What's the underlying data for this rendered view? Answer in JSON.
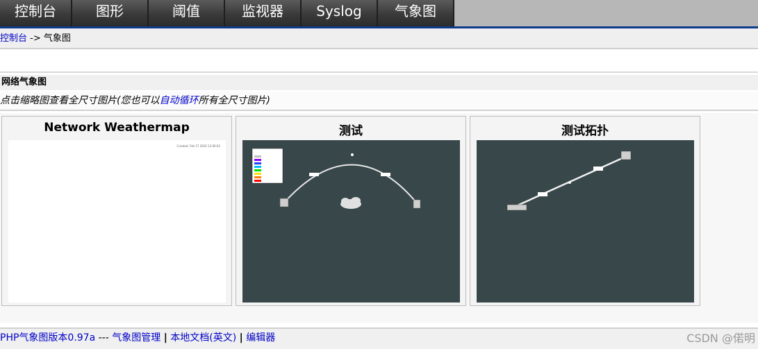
{
  "tabs": [
    "控制台",
    "图形",
    "阈值",
    "监视器",
    "Syslog",
    "气象图"
  ],
  "breadcrumb": {
    "home": "控制台",
    "separator": "->",
    "current": "气象图"
  },
  "section": {
    "title": "网络气象图",
    "hint_prefix": "点击缩略图查看全尺寸图片(您也可以",
    "hint_link": "自动循环",
    "hint_suffix": "所有全尺寸图片)"
  },
  "maps": [
    {
      "title": "Network Weathermap",
      "caption": "Created: Feb 17 2020 12:06:02"
    },
    {
      "title": "测试"
    },
    {
      "title": "测试拓扑"
    }
  ],
  "footer": {
    "version": "PHP气象图版本0.97a",
    "sep": "---",
    "manage": "气象图管理",
    "docs": "本地文档(英文)",
    "editor": "编辑器",
    "bar": "|"
  },
  "watermark": "CSDN @偌明",
  "colors": {
    "tab_bg": "#3a3a3a",
    "accent": "#0d3a8a",
    "link": "#0000c8",
    "map_bg": "#38474a"
  }
}
